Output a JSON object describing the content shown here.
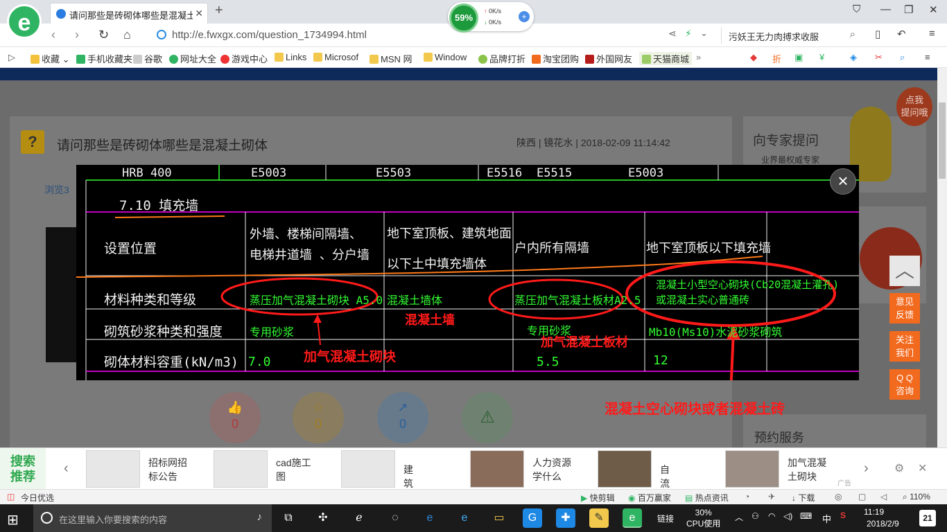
{
  "browser": {
    "tab_title": "请问那些是砖砌体哪些是混凝土砌",
    "new_tab": "+",
    "url": "http://e.fwxgx.com/question_1734994.html",
    "speed": {
      "percent": "59%",
      "up": "0K/s",
      "down": "0K/s"
    },
    "search_text": "污妖王无力肉搏求收服",
    "bookmarks": [
      "收藏",
      "手机收藏夹",
      "谷歌",
      "网址大全",
      "游戏中心",
      "Links",
      "Microsof",
      "MSN 网",
      "Window",
      "品牌打折",
      "淘宝团购",
      "外国网友",
      "天猫商城"
    ]
  },
  "question": {
    "title": "请问那些是砖砌体哪些是混凝土砌体",
    "meta": "陕西 | 镜花水 | 2018-02-09 11:14:42",
    "browse": "浏览3",
    "actions": [
      {
        "icon": "👍",
        "count": "0"
      },
      {
        "icon": "☆",
        "count": "0"
      },
      {
        "icon": "↗",
        "count": "0"
      },
      {
        "icon": "⚠",
        "count": ""
      }
    ]
  },
  "sidebar": {
    "ask_title": "向专家提问",
    "ask_sub": "业界最权威专家",
    "bubble": "点我\n提问哦",
    "appointment": "预约服务"
  },
  "float_buttons": {
    "top": "︿",
    "feedback": "意见反馈",
    "follow": "关注我们",
    "qq": "QQ咨询"
  },
  "modal": {
    "close": "×",
    "header_row": [
      "HRB 400",
      "E5003",
      "E5503",
      "E5516",
      "E5515",
      "E5003"
    ],
    "section": "7.10  填充墙",
    "table": {
      "headers": [
        "设置位置",
        "外墙、楼梯间隔墙、\n电梯井道墙 、分户墙",
        "地下室顶板、建筑地面\n以下土中填充墙体",
        "户内所有隔墙",
        "地下室顶板以下填充墙"
      ],
      "rows": [
        {
          "label": "材料种类和等级",
          "cells": [
            "蒸压加气混凝土砌块 A5.0",
            "混凝土墙体",
            "蒸压加气混凝土板材A2.5",
            "混凝土小型空心砌块(Cb20混凝土灌孔)\n或混凝土实心普通砖"
          ]
        },
        {
          "label": "砌筑砂浆种类和强度",
          "cells": [
            "专用砂浆",
            "",
            "专用砂浆",
            "Mb10(Ms10)水泥砂浆砌筑"
          ]
        },
        {
          "label": "砌体材料容重(kN/m3)",
          "cells": [
            "7.0",
            "",
            "5.5",
            "12"
          ]
        }
      ]
    },
    "annotations": [
      "加气混凝土砌块",
      "混凝土墙",
      "加气混凝土板材",
      "混凝土空心砌块或者混凝土砖"
    ]
  },
  "recommend": {
    "label": "搜索\n推荐",
    "items": [
      "招标网招\n标公告",
      "cad施工\n图",
      "建筑识图",
      "人力资源\n学什么",
      "自流平",
      "加气混凝\n土砌块"
    ],
    "ad": "广告"
  },
  "statusbar": {
    "left": "今日优选",
    "items": [
      "快剪辑",
      "百万赢家",
      "热点资讯",
      "下载",
      "110%"
    ]
  },
  "taskbar": {
    "search_placeholder": "在这里输入你要搜索的内容",
    "link": "链接",
    "cpu": "30%\nCPU使用",
    "ime": "中",
    "time": "11:19",
    "date": "2018/2/9",
    "notifications": "21"
  },
  "colors": {
    "cad_green": "#33ff33",
    "cad_magenta": "#ff00ff",
    "annotation_red": "#ff1a1a",
    "orange_button": "#f26a1e"
  }
}
